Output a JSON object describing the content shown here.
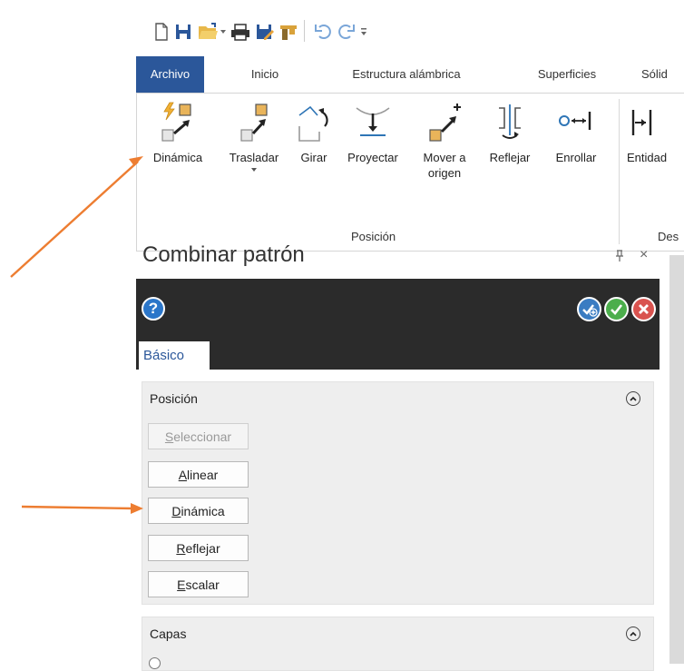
{
  "quick_access": {
    "icons": [
      "new-file-icon",
      "save-icon",
      "open-folder-icon",
      "dropdown-arrow-icon",
      "print-icon",
      "save-edit-icon",
      "library-icon",
      "undo-icon",
      "redo-icon",
      "customize-icon"
    ]
  },
  "ribbon_tabs": [
    {
      "label": "Archivo",
      "active": true
    },
    {
      "label": "Inicio",
      "active": false
    },
    {
      "label": "Estructura alámbrica",
      "active": false
    },
    {
      "label": "Superficies",
      "active": false
    },
    {
      "label": "Sólid",
      "active": false
    }
  ],
  "ribbon": {
    "buttons": [
      {
        "label": "Dinámica",
        "icon": "dynamic-move-icon"
      },
      {
        "label": "Trasladar",
        "icon": "translate-icon",
        "has_dropdown": true
      },
      {
        "label": "Girar",
        "icon": "rotate-icon"
      },
      {
        "label": "Proyectar",
        "icon": "project-icon"
      },
      {
        "label": "Mover a",
        "label2": "origen",
        "icon": "move-to-origin-icon"
      },
      {
        "label": "Reflejar",
        "icon": "mirror-icon"
      },
      {
        "label": "Enrollar",
        "icon": "wrap-icon"
      },
      {
        "label": "Entidad",
        "icon": "entity-icon"
      }
    ],
    "group_label": "Posición",
    "group_label_next": "Des"
  },
  "panel": {
    "title": "Combinar patrón",
    "pin_glyph": "ᵖ",
    "close_glyph": "×",
    "tab": "Básico",
    "section_position": {
      "title": "Posición",
      "buttons": [
        {
          "pre": "",
          "u": "S",
          "post": "eleccionar",
          "disabled": true
        },
        {
          "pre": "",
          "u": "A",
          "post": "linear",
          "disabled": false
        },
        {
          "pre": "",
          "u": "D",
          "post": "inámica",
          "disabled": false
        },
        {
          "pre": "",
          "u": "R",
          "post": "eflejar",
          "disabled": false
        },
        {
          "pre": "",
          "u": "E",
          "post": "scalar",
          "disabled": false
        }
      ]
    },
    "section_layers": {
      "title": "Capas"
    }
  },
  "colors": {
    "accent": "#2b579a",
    "arrow": "#ed7d31",
    "dark_header": "#2b2b2b",
    "section_bg": "#eeeeee"
  }
}
